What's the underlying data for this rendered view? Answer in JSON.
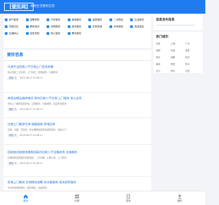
{
  "header": {
    "logo": "【便民网】",
    "slogan": "本地生活便民信息"
  },
  "categories": [
    "房产租售",
    "招聘求职",
    "汽车服务",
    "家政服务",
    "装修建材",
    "二手物品",
    "生活服务",
    "同城交友",
    "教育培训",
    "宠物服务",
    "商务服务",
    "农林牧渔",
    "本地商家",
    "旅游酒店",
    "店铺转让",
    "批发采购",
    "丽人服务",
    "票务服务",
    "",
    "",
    ""
  ],
  "listing": {
    "title": "便民信息",
    "items": [
      {
        "title": "乐清专业回收二手空调上门现金结算",
        "desc": "高价回收二手空调，上门评估，现场结算，长期有效",
        "views": "浏览: 3",
        "date": "2025-08-17 01:38:11"
      },
      {
        "title": "帅丽宝精品维修电话 原价回收二手空调 上门服务 安心无忧",
        "desc": "本地上门维修各类家电，正规服务，价格透明，欢迎来电咨询",
        "views": "浏览: 3",
        "date": "2025-08-17 01:38:11"
      },
      {
        "title": "白城上门维修空调 电器维修 家电回收",
        "desc": "空调、冰箱、洗衣机、热水器等各类家电维修回收，快速上门",
        "views": "浏览: 3",
        "date": "2025-08-17 01:38:11"
      },
      {
        "title": "回收废旧电缆线电缆线高价回收二手设备收购 全城服务",
        "desc": "长期回收各类废旧电缆电线、二手设备，价格公道，上门看货",
        "views": "浏览: 3",
        "date": "2025-08-17 01:38:11"
      },
      {
        "title": "家电上门维修 空调移机加氟 热水器维修 清洗保养服务",
        "desc": "专业家电维修团队，服务周到，欢迎咨询",
        "views": "浏览: 3",
        "date": "2025-08-17 01:38:11"
      }
    ]
  },
  "sidebar": {
    "card1_title": "信息发布信息",
    "card2_title": "热门城市",
    "cities": [
      "北京",
      "上海",
      "广州",
      "深圳",
      "天津",
      "重庆",
      "杭州",
      "成都",
      "武汉",
      "南京",
      "西安",
      "苏州",
      "长沙",
      "郑州",
      "青岛"
    ]
  },
  "bottom_nav": [
    {
      "label": "首页",
      "icon": "home-icon"
    },
    {
      "label": "分类",
      "icon": "category-icon"
    },
    {
      "label": "发布",
      "icon": "publish-icon"
    },
    {
      "label": "我的",
      "icon": "user-icon"
    }
  ],
  "colors": {
    "brand": "#1e7cf0",
    "link": "#1e6fd8"
  }
}
